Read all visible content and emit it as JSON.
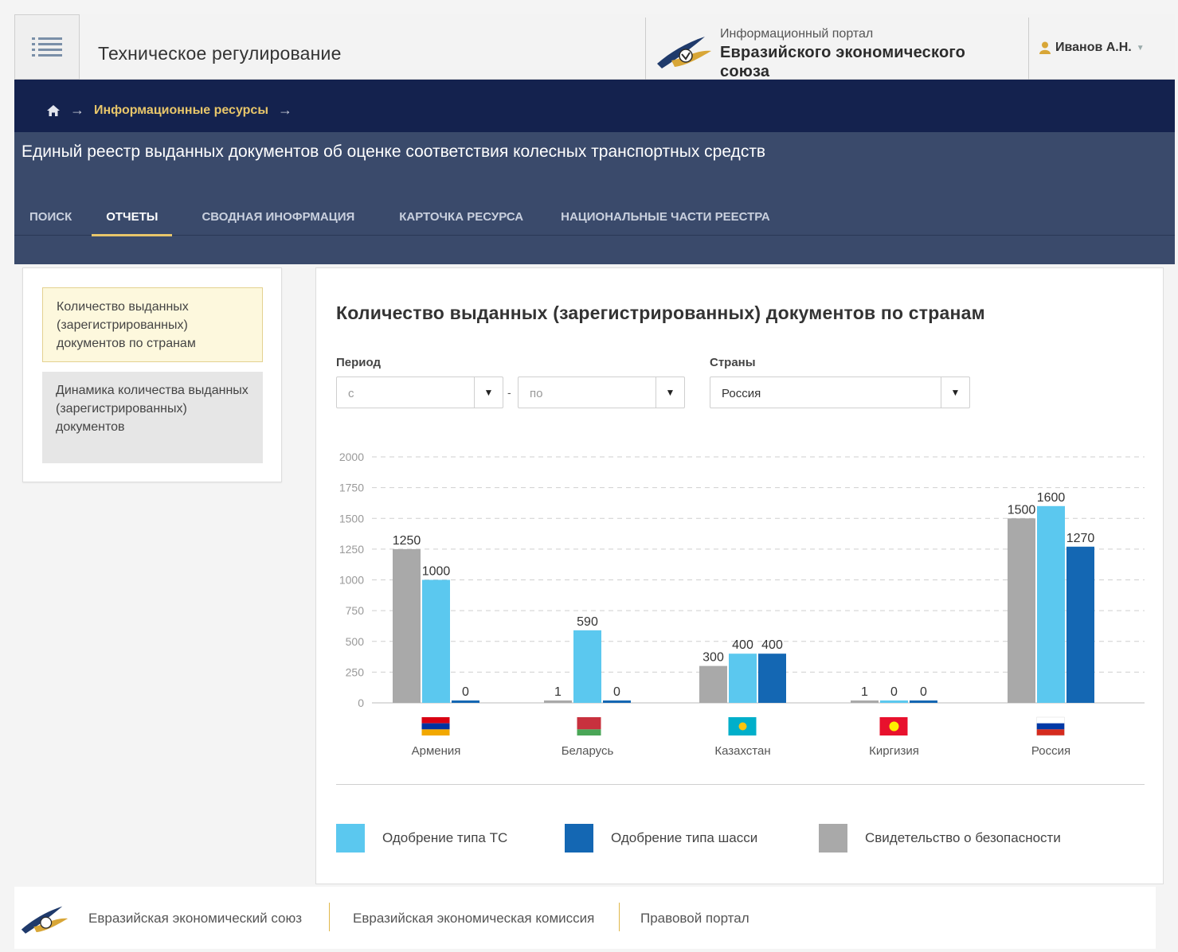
{
  "header": {
    "app_title": "Техническое регулирование",
    "portal_subtitle": "Информационный портал",
    "portal_title": "Евразийского экономического союза",
    "user_name": "Иванов А.Н.",
    "icons": [
      "menu-icon",
      "eaeu-logo",
      "user-icon",
      "caret-down-icon"
    ]
  },
  "breadcrumb": {
    "home_icon": "home-icon",
    "items": [
      "Информационные ресурсы"
    ]
  },
  "registry": {
    "title": "Единый реестр выданных документов об оценке соответствия колесных транспортных средств",
    "tabs": [
      {
        "label": "ПОИСК",
        "active": false
      },
      {
        "label": "ОТЧЕТЫ",
        "active": true
      },
      {
        "label": "СВОДНАЯ ИНОФРМАЦИЯ",
        "active": false
      },
      {
        "label": "КАРТОЧКА РЕСУРСА",
        "active": false
      },
      {
        "label": "НАЦИОНАЛЬНЫЕ ЧАСТИ РЕЕСТРА",
        "active": false
      }
    ]
  },
  "sidebar": {
    "items": [
      {
        "label": "Количество выданных (зарегистрированных) документов по странам",
        "active": true
      },
      {
        "label": "Динамика количества выданных (зарегистрированных) документов",
        "active": false
      }
    ]
  },
  "main": {
    "title": "Количество выданных (зарегистрированных) документов по странам",
    "period_label": "Период",
    "period_from_placeholder": "с",
    "period_separator": "-",
    "period_to_placeholder": "по",
    "countries_label": "Страны",
    "countries_value": "Россия"
  },
  "chart_data": {
    "type": "bar",
    "categories": [
      "Армения",
      "Беларусь",
      "Казахстан",
      "Киргизия",
      "Россия"
    ],
    "series": [
      {
        "name": "Свидетельство о безопасности",
        "color": "#a9a9a9",
        "values": [
          1250,
          1,
          300,
          1,
          1500
        ]
      },
      {
        "name": "Одобрение типа ТС",
        "color": "#5bc8ef",
        "values": [
          1000,
          590,
          400,
          0,
          1600
        ]
      },
      {
        "name": "Одобрение типа шасси",
        "color": "#1467b3",
        "values": [
          0,
          0,
          400,
          0,
          1270
        ]
      }
    ],
    "ylim": [
      0,
      2000
    ],
    "yticks": [
      0,
      250,
      500,
      750,
      1000,
      1250,
      1500,
      1750,
      2000
    ],
    "grid": true,
    "legend_position": "bottom",
    "legend_order": [
      "Одобрение типа ТС",
      "Одобрение типа шасси",
      "Свидетельство о безопасности"
    ],
    "flags": [
      "flag-armenia-icon",
      "flag-belarus-icon",
      "flag-kazakhstan-icon",
      "flag-kyrgyzstan-icon",
      "flag-russia-icon"
    ]
  },
  "footer": {
    "links": [
      "Евразийская экономический союз",
      "Евразийская экономическая комиссия",
      "Правовой портал"
    ]
  }
}
